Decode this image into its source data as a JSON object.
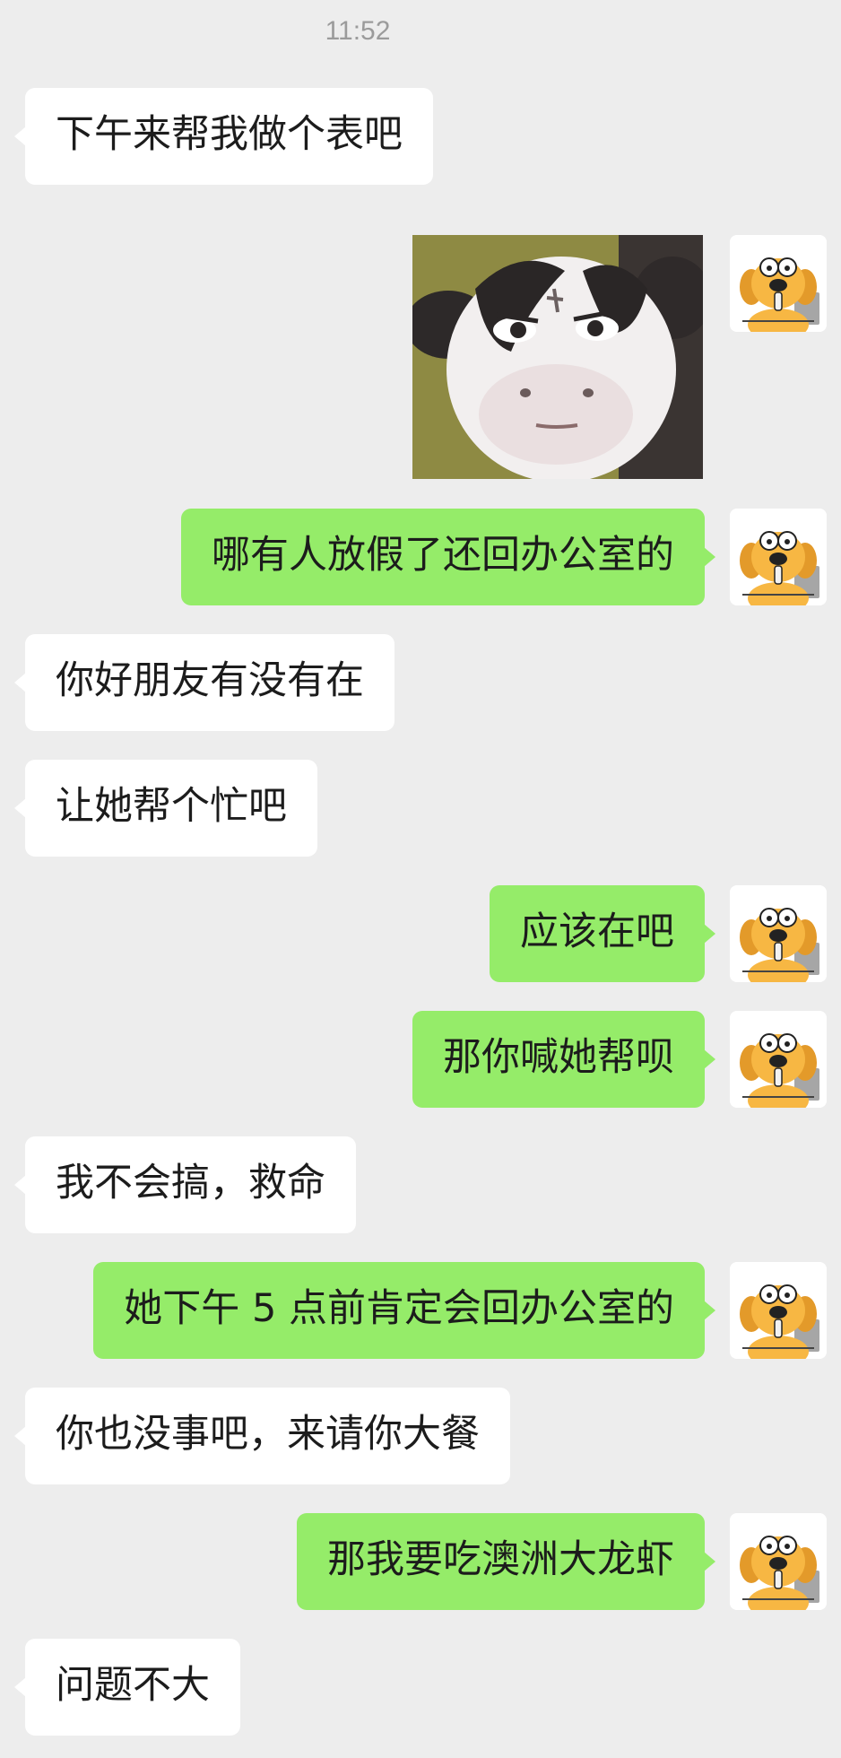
{
  "chat": {
    "timestamp": "11:52",
    "messages": [
      {
        "id": 0,
        "side": "in",
        "text": "下午来帮我做个表吧"
      },
      {
        "id": 1,
        "side": "out",
        "type": "sticker",
        "sticker": "cow-face-sticker"
      },
      {
        "id": 2,
        "side": "out",
        "text": "哪有人放假了还回办公室的"
      },
      {
        "id": 3,
        "side": "in",
        "text": "你好朋友有没有在"
      },
      {
        "id": 4,
        "side": "in",
        "text": "让她帮个忙吧"
      },
      {
        "id": 5,
        "side": "out",
        "text": "应该在吧"
      },
      {
        "id": 6,
        "side": "out",
        "text": "那你喊她帮呗"
      },
      {
        "id": 7,
        "side": "in",
        "text": "我不会搞，救命"
      },
      {
        "id": 8,
        "side": "out",
        "text": "她下午 5 点前肯定会回办公室的"
      },
      {
        "id": 9,
        "side": "in",
        "text": "你也没事吧，来请你大餐"
      },
      {
        "id": 10,
        "side": "out",
        "text": "那我要吃澳洲大龙虾"
      },
      {
        "id": 11,
        "side": "in",
        "text": "问题不大"
      }
    ]
  },
  "colors": {
    "background": "#ededed",
    "incoming_bubble": "#ffffff",
    "outgoing_bubble": "#95ec69",
    "timestamp_text": "#9b9b9b"
  },
  "icons": {
    "self_avatar": "cartoon-dog-avatar-icon"
  }
}
